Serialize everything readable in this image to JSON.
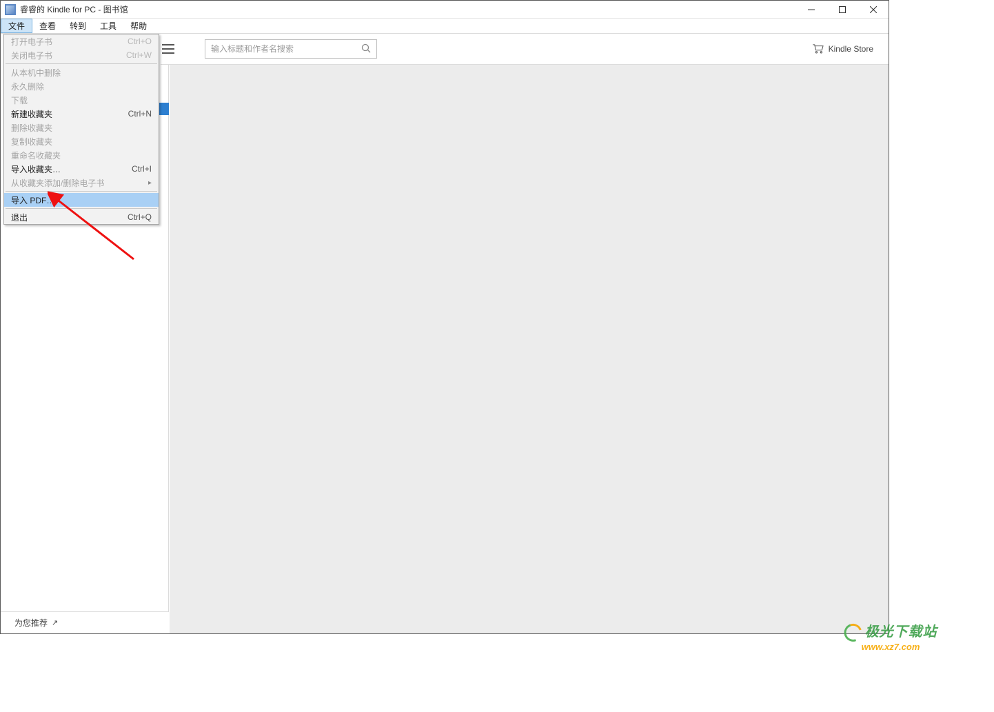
{
  "title": "睿睿的 Kindle for PC - 图书馆",
  "menubar": {
    "file": "文件",
    "view": "查看",
    "goto": "转到",
    "tools": "工具",
    "help": "帮助"
  },
  "dropdown": {
    "open_ebook": "打开电子书",
    "open_ebook_sc": "Ctrl+O",
    "close_ebook": "关闭电子书",
    "close_ebook_sc": "Ctrl+W",
    "delete_local": "从本机中删除",
    "delete_perm": "永久删除",
    "download": "下载",
    "new_collection": "新建收藏夹",
    "new_collection_sc": "Ctrl+N",
    "delete_collection": "删除收藏夹",
    "copy_collection": "复制收藏夹",
    "rename_collection": "重命名收藏夹",
    "import_collection": "导入收藏夹…",
    "import_collection_sc": "Ctrl+I",
    "collection_add_del": "从收藏夹添加/删除电子书",
    "import_pdf": "导入 PDF…",
    "exit": "退出",
    "exit_sc": "Ctrl+Q"
  },
  "search": {
    "placeholder": "输入标题和作者名搜索"
  },
  "store_link": "Kindle Store",
  "bottom": {
    "recommend": "为您推荐"
  },
  "watermark": {
    "line1": "极光下载站",
    "line2": "www.xz7.com"
  }
}
